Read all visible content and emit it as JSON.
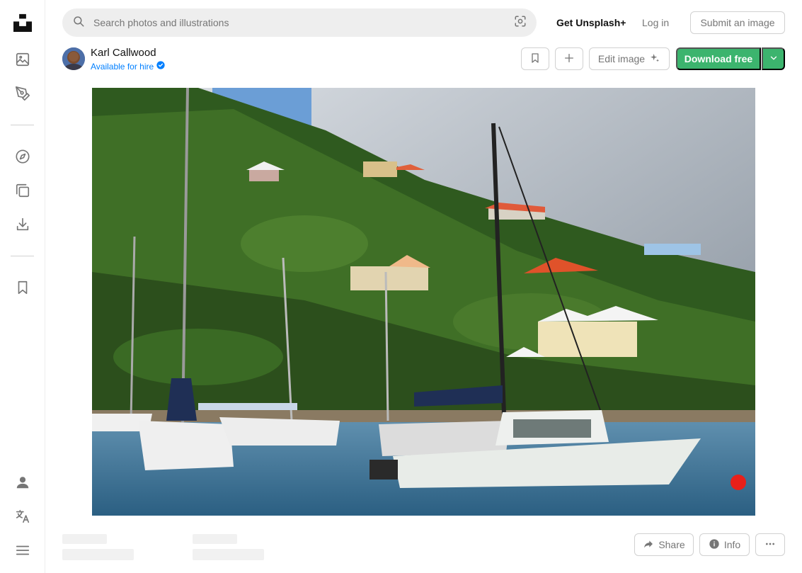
{
  "search": {
    "placeholder": "Search photos and illustrations"
  },
  "header": {
    "plus_label": "Get Unsplash+",
    "login_label": "Log in",
    "submit_label": "Submit an image"
  },
  "author": {
    "name": "Karl Callwood",
    "hire_label": "Available for hire"
  },
  "actions": {
    "edit_label": "Edit image",
    "download_label": "Download free"
  },
  "footer": {
    "share_label": "Share",
    "info_label": "Info"
  },
  "colors": {
    "accent_green": "#3cb46e",
    "link_blue": "#007fff",
    "muted_text": "#767676"
  },
  "sidebar": {
    "icons": [
      "unsplash-logo",
      "photos-icon",
      "illustrations-icon",
      "explore-icon",
      "collections-icon",
      "download-icon",
      "bookmark-icon",
      "user-icon",
      "language-icon",
      "menu-icon"
    ]
  }
}
